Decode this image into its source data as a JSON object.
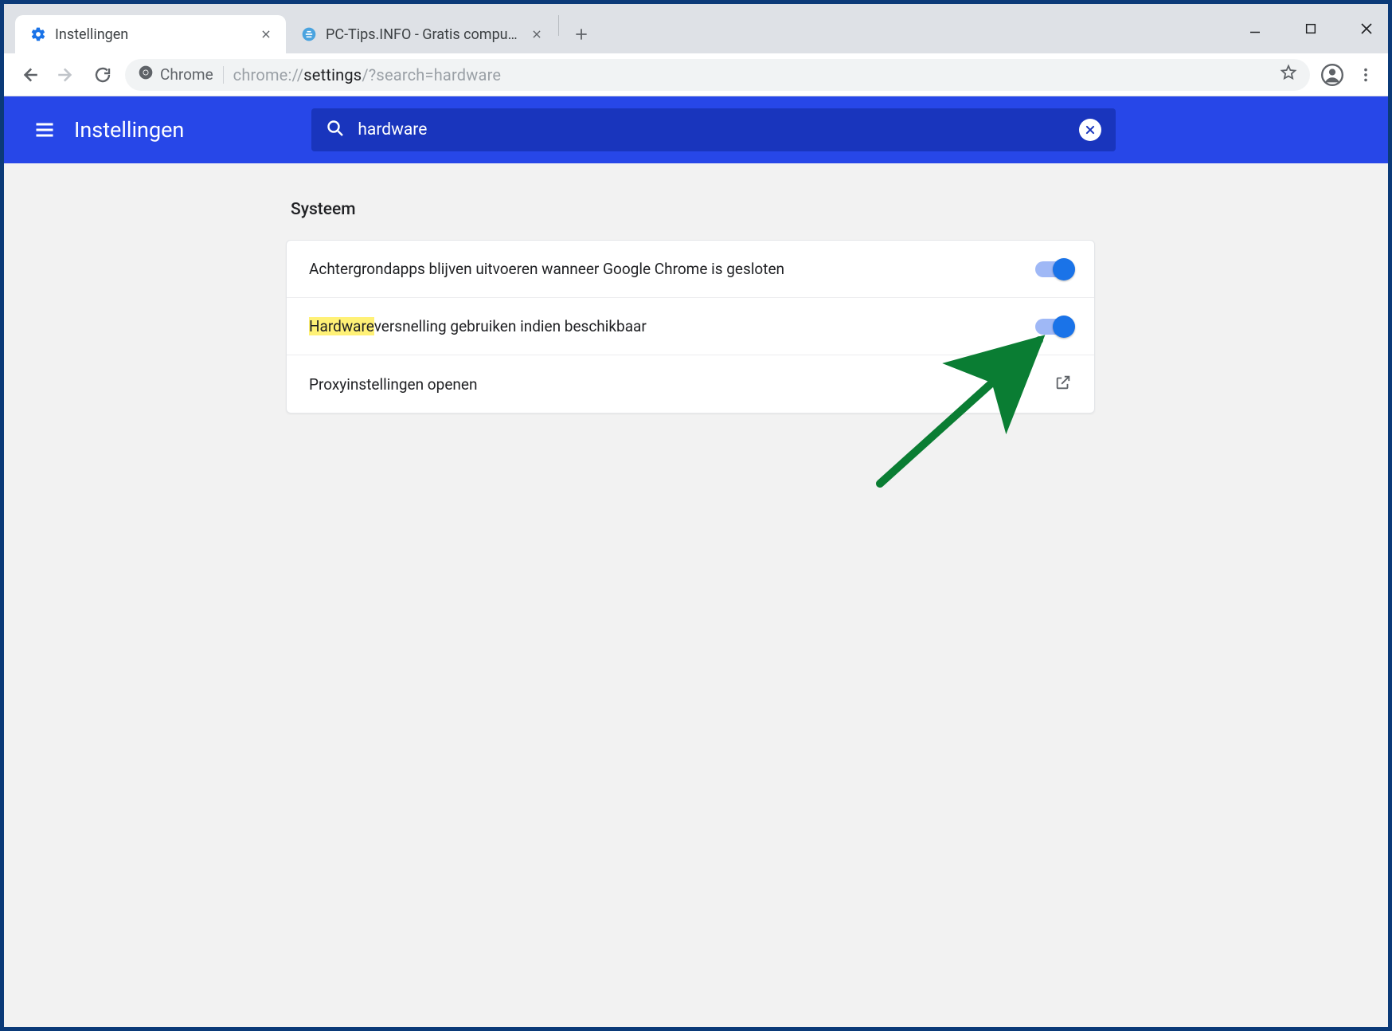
{
  "tabs": [
    {
      "title": "Instellingen",
      "active": true
    },
    {
      "title": "PC-Tips.INFO - Gratis computer t",
      "active": false
    }
  ],
  "omnibox": {
    "chip_label": "Chrome",
    "url_prefix": "chrome://",
    "url_strong": "settings",
    "url_suffix": "/?search=hardware"
  },
  "settings": {
    "header_title": "Instellingen",
    "search_value": "hardware",
    "section_title": "Systeem",
    "rows": {
      "background_apps": {
        "label": "Achtergrondapps blijven uitvoeren wanneer Google Chrome is gesloten",
        "on": true
      },
      "hw_accel": {
        "highlight": "Hardware",
        "rest": "versnelling gebruiken indien beschikbaar",
        "on": true
      },
      "proxy": {
        "label": "Proxyinstellingen openen"
      }
    }
  }
}
